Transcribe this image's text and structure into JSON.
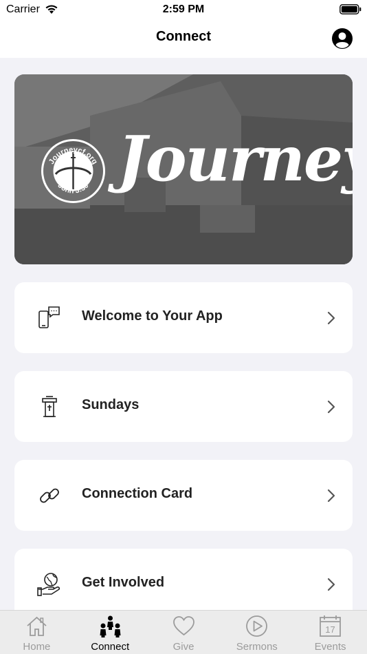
{
  "status_bar": {
    "carrier": "Carrier",
    "time": "2:59 PM"
  },
  "nav": {
    "title": "Connect"
  },
  "hero": {
    "logo_top_text": "Journeycf.org",
    "logo_bottom_text": "John 3:30",
    "wordmark": "Journey"
  },
  "menu": [
    {
      "label": "Welcome to Your App",
      "icon": "phone-chat-icon"
    },
    {
      "label": "Sundays",
      "icon": "pulpit-icon"
    },
    {
      "label": "Connection Card",
      "icon": "link-icon"
    },
    {
      "label": "Get Involved",
      "icon": "globe-hand-icon"
    }
  ],
  "tabs": [
    {
      "label": "Home",
      "icon": "home-icon",
      "active": false
    },
    {
      "label": "Connect",
      "icon": "people-icon",
      "active": true
    },
    {
      "label": "Give",
      "icon": "heart-icon",
      "active": false
    },
    {
      "label": "Sermons",
      "icon": "play-icon",
      "active": false
    },
    {
      "label": "Events",
      "icon": "calendar-icon",
      "active": false,
      "badge": "17"
    }
  ],
  "colors": {
    "background": "#f2f2f7",
    "card": "#ffffff",
    "tab_inactive": "#9b9b9b",
    "tab_active": "#000000"
  }
}
